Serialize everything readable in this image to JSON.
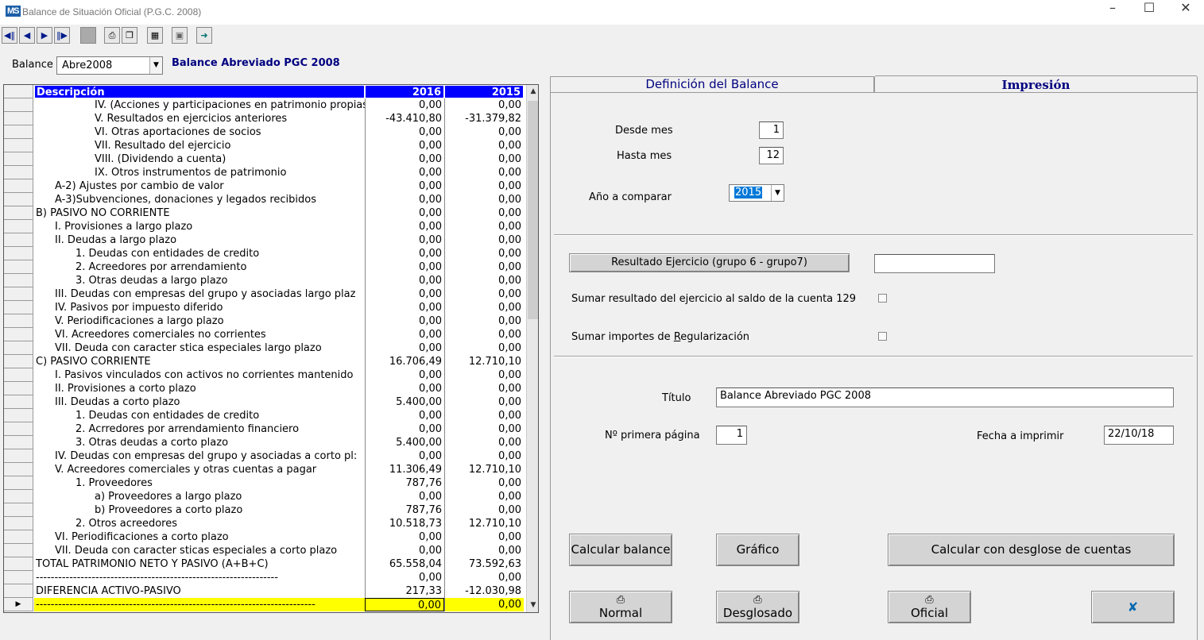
{
  "window": {
    "title": "Balance de Situación Oficial  (P.G.C. 2008)",
    "logo": "MS"
  },
  "toolbar": {
    "icons": [
      "first-icon",
      "prev-icon",
      "next-icon",
      "last-icon",
      "stop-icon",
      "print-icon",
      "book-icon",
      "calculator-icon",
      "preview-icon",
      "exit-icon"
    ]
  },
  "balance": {
    "label": "Balance",
    "selected": "Abre2008",
    "name": "Balance Abreviado PGC 2008"
  },
  "grid": {
    "headers": {
      "desc": "Descripción",
      "y1": "2016",
      "y2": "2015"
    },
    "rows": [
      {
        "d": "IV. (Acciones y participaciones en patrimonio propias)",
        "a": "0,00",
        "b": "0,00",
        "i": 3
      },
      {
        "d": "V. Resultados en ejercicios anteriores",
        "a": "-43.410,80",
        "b": "-31.379,82",
        "i": 3
      },
      {
        "d": "VI. Otras aportaciones de socios",
        "a": "0,00",
        "b": "0,00",
        "i": 3
      },
      {
        "d": "VII. Resultado del ejercicio",
        "a": "0,00",
        "b": "0,00",
        "i": 3
      },
      {
        "d": "VIII. (Dividendo a cuenta)",
        "a": "0,00",
        "b": "0,00",
        "i": 3
      },
      {
        "d": "IX. Otros instrumentos de patrimonio",
        "a": "0,00",
        "b": "0,00",
        "i": 3
      },
      {
        "d": "A-2) Ajustes por cambio de valor",
        "a": "0,00",
        "b": "0,00",
        "i": 1
      },
      {
        "d": "A-3)Subvenciones, donaciones y legados recibidos",
        "a": "0,00",
        "b": "0,00",
        "i": 1
      },
      {
        "d": "B) PASIVO NO CORRIENTE",
        "a": "0,00",
        "b": "0,00",
        "i": 0
      },
      {
        "d": "I. Provisiones a largo plazo",
        "a": "0,00",
        "b": "0,00",
        "i": 1
      },
      {
        "d": "II. Deudas a largo plazo",
        "a": "0,00",
        "b": "0,00",
        "i": 1
      },
      {
        "d": "1. Deudas con entidades de credito",
        "a": "0,00",
        "b": "0,00",
        "i": 2
      },
      {
        "d": "2. Acreedores por arrendamiento",
        "a": "0,00",
        "b": "0,00",
        "i": 2
      },
      {
        "d": "3. Otras deudas a largo plazo",
        "a": "0,00",
        "b": "0,00",
        "i": 2
      },
      {
        "d": "III. Deudas con empresas del grupo y asociadas largo plaz",
        "a": "0,00",
        "b": "0,00",
        "i": 1
      },
      {
        "d": "IV. Pasivos por impuesto diferido",
        "a": "0,00",
        "b": "0,00",
        "i": 1
      },
      {
        "d": "V. Periodificaciones a largo plazo",
        "a": "0,00",
        "b": "0,00",
        "i": 1
      },
      {
        "d": "VI. Acreedores comerciales no corrientes",
        "a": "0,00",
        "b": "0,00",
        "i": 1
      },
      {
        "d": "VII. Deuda con caracter stica especiales largo plazo",
        "a": "0,00",
        "b": "0,00",
        "i": 1
      },
      {
        "d": "C) PASIVO CORRIENTE",
        "a": "16.706,49",
        "b": "12.710,10",
        "i": 0
      },
      {
        "d": "I. Pasivos vinculados con activos no corrientes mantenido",
        "a": "0,00",
        "b": "0,00",
        "i": 1
      },
      {
        "d": "II. Provisiones a corto plazo",
        "a": "0,00",
        "b": "0,00",
        "i": 1
      },
      {
        "d": "III. Deudas a corto plazo",
        "a": "5.400,00",
        "b": "0,00",
        "i": 1
      },
      {
        "d": "1. Deudas con entidades de credito",
        "a": "0,00",
        "b": "0,00",
        "i": 2
      },
      {
        "d": "2. Acrredores por arrendamiento financiero",
        "a": "0,00",
        "b": "0,00",
        "i": 2
      },
      {
        "d": "3. Otras deudas a corto plazo",
        "a": "5.400,00",
        "b": "0,00",
        "i": 2
      },
      {
        "d": "IV. Deudas con empresas del grupo y asociadas a corto pl:",
        "a": "0,00",
        "b": "0,00",
        "i": 1
      },
      {
        "d": "V. Acreedores comerciales y otras cuentas a pagar",
        "a": "11.306,49",
        "b": "12.710,10",
        "i": 1
      },
      {
        "d": "1. Proveedores",
        "a": "787,76",
        "b": "0,00",
        "i": 2
      },
      {
        "d": "a) Proveedores a largo plazo",
        "a": "0,00",
        "b": "0,00",
        "i": 3
      },
      {
        "d": "b) Proveedores a corto plazo",
        "a": "787,76",
        "b": "0,00",
        "i": 3
      },
      {
        "d": "2. Otros acreedores",
        "a": "10.518,73",
        "b": "12.710,10",
        "i": 2
      },
      {
        "d": "VI. Periodificaciones a corto plazo",
        "a": "0,00",
        "b": "0,00",
        "i": 1
      },
      {
        "d": "VII. Deuda con caracter sticas especiales a corto plazo",
        "a": "0,00",
        "b": "0,00",
        "i": 1
      },
      {
        "d": "TOTAL PATRIMONIO NETO Y PASIVO (A+B+C)",
        "a": "65.558,04",
        "b": "73.592,63",
        "i": 0
      },
      {
        "d": "-----------------------------------------------------------------",
        "a": "0,00",
        "b": "0,00",
        "i": 0
      },
      {
        "d": "DIFERENCIA ACTIVO-PASIVO",
        "a": "217,33",
        "b": "-12.030,98",
        "i": 0
      },
      {
        "d": "---------------------------------------------------------------------------",
        "a": "0,00",
        "b": "0,00",
        "i": 0,
        "hl": true,
        "cur": true
      }
    ]
  },
  "tabs": {
    "def": "Definición del Balance",
    "imp": "Impresión"
  },
  "print": {
    "desde_label": "Desde mes",
    "desde": "1",
    "hasta_label": "Hasta mes",
    "hasta": "12",
    "anio_label": "Año a comparar",
    "anio": "2015",
    "resultado_btn": "Resultado Ejercicio (grupo 6 - grupo7)",
    "resultado": "",
    "sumar129_label": "Sumar resultado del ejercicio al saldo de la cuenta 129",
    "sumar_reg_pre": "Sumar importes de ",
    "sumar_reg_u": "R",
    "sumar_reg_post": "egularización",
    "titulo_label": "Título",
    "titulo": "Balance Abreviado PGC 2008",
    "pagina_label": "Nº primera página",
    "pagina": "1",
    "fecha_label": "Fecha a imprimir",
    "fecha": "22/10/18"
  },
  "buttons": {
    "calcular": "Calcular balance",
    "grafico": "Gráfico",
    "desglose": "Calcular con desglose de cuentas",
    "normal": "Normal",
    "desglosado": "Desglosado",
    "oficial": "Oficial"
  }
}
